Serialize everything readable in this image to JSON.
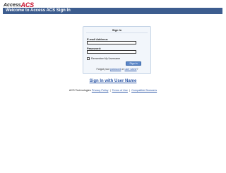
{
  "header": {
    "logo_prefix": "Access",
    "logo_suffix": "ACS",
    "title": "Welcome to Access ACS Sign In"
  },
  "signin": {
    "heading": "Sign In",
    "email_label": "E-mail Address:",
    "email_value": "",
    "password_label": "Password:",
    "password_value": "",
    "remember_label": "Remember My Username",
    "submit_label": "Sign In",
    "forgot_prefix": "Forgot your",
    "forgot_password_link": "password",
    "forgot_or": "or",
    "forgot_username_link": "user name",
    "forgot_suffix": "?"
  },
  "alt_signin": {
    "label": "Sign In with User Name"
  },
  "footer": {
    "company": "ACS Technologies",
    "links": [
      "Privacy Policy",
      "Terms of Use",
      "Compatible Browsers"
    ],
    "separator": "|"
  },
  "colors": {
    "title_bar": "#3d5d8f",
    "link": "#2b56a6",
    "logo_accent": "#c8102e",
    "panel_bg": "#f2f6fb"
  }
}
